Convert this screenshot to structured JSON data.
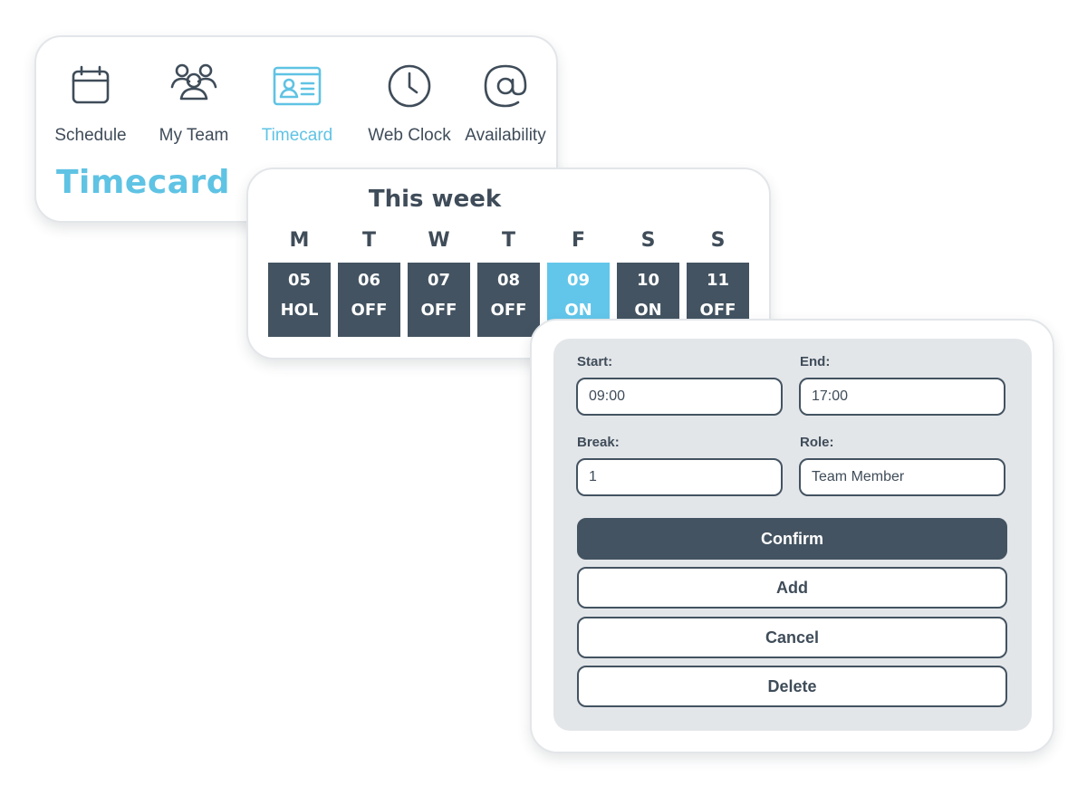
{
  "nav": {
    "items": [
      {
        "label": "Schedule",
        "icon": "calendar-icon"
      },
      {
        "label": "My Team",
        "icon": "team-icon"
      },
      {
        "label": "Timecard",
        "icon": "id-card-icon",
        "active": true
      },
      {
        "label": "Web Clock",
        "icon": "clock-icon"
      },
      {
        "label": "Availability",
        "icon": "at-sign-icon"
      }
    ],
    "title": "Timecard"
  },
  "week": {
    "title": "This week",
    "days": [
      {
        "letter": "M",
        "date": "05",
        "status": "HOL"
      },
      {
        "letter": "T",
        "date": "06",
        "status": "OFF"
      },
      {
        "letter": "W",
        "date": "07",
        "status": "OFF"
      },
      {
        "letter": "T",
        "date": "08",
        "status": "OFF"
      },
      {
        "letter": "F",
        "date": "09",
        "status": "ON",
        "selected": true
      },
      {
        "letter": "S",
        "date": "10",
        "status": "ON"
      },
      {
        "letter": "S",
        "date": "11",
        "status": "OFF"
      }
    ]
  },
  "form": {
    "start": {
      "label": "Start:",
      "value": "09:00"
    },
    "end": {
      "label": "End:",
      "value": "17:00"
    },
    "break": {
      "label": "Break:",
      "value": "1"
    },
    "role": {
      "label": "Role:",
      "value": "Team Member"
    },
    "buttons": {
      "confirm": "Confirm",
      "add": "Add",
      "cancel": "Cancel",
      "delete": "Delete"
    }
  },
  "colors": {
    "accent": "#5fc3e4",
    "dark": "#435361",
    "text": "#3f4c59",
    "panel": "#e3e6e9"
  }
}
